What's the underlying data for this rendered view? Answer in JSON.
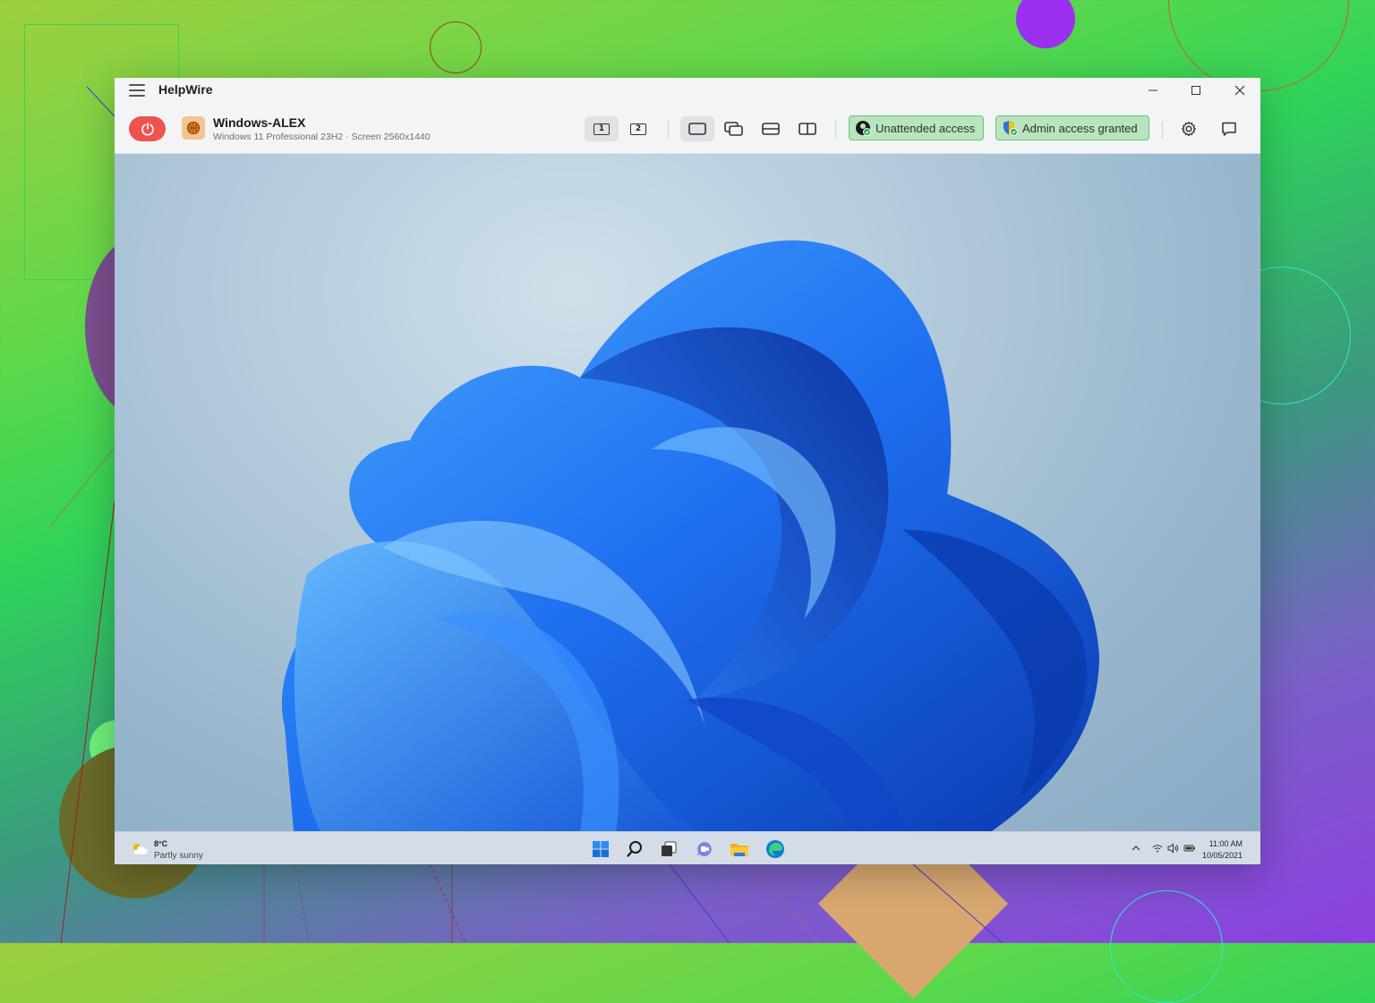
{
  "app": {
    "title": "HelpWire"
  },
  "device": {
    "name": "Windows-ALEX",
    "subtitle": "Windows 11 Professional 23H2 · Screen 2560x1440"
  },
  "toolbar": {
    "monitor_1": "1",
    "monitor_2": "2",
    "unattended_label": "Unattended access",
    "admin_label": "Admin access granted"
  },
  "taskbar": {
    "temperature": "8°C",
    "weather": "Partly sunny",
    "time": "11:00 AM",
    "date": "10/05/2021"
  },
  "colors": {
    "power": "#ef5350",
    "badge_bg": "#b9e4bf",
    "badge_border": "#6cc27a",
    "wallpaper_bloom": "#1e6ff0"
  }
}
